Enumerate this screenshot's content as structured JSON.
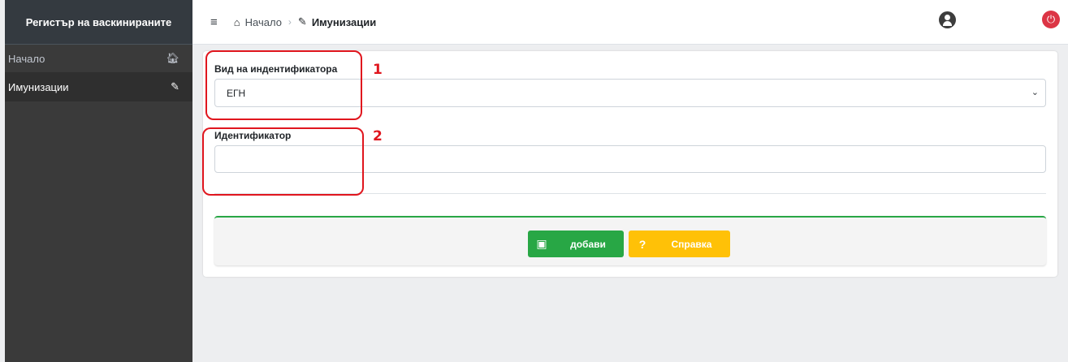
{
  "sidebar": {
    "brand": "Регистър на васкинираните",
    "items": [
      {
        "label": "Начало",
        "icon": "home-icon"
      },
      {
        "label": "Имунизации",
        "icon": "syringe-icon"
      }
    ]
  },
  "header": {
    "breadcrumb": {
      "home": "Начало",
      "current": "Имунизации"
    }
  },
  "form": {
    "id_type_label": "Вид на индентификатора",
    "id_type_value": "ЕГН",
    "identifier_label": "Идентификатор",
    "identifier_value": "",
    "add_button": "добави",
    "help_button": "Справка"
  },
  "annotations": {
    "one": "1",
    "two": "2"
  },
  "colors": {
    "add": "#28a745",
    "help": "#ffc107",
    "power": "#dc3545",
    "annotation": "#e0161e"
  }
}
